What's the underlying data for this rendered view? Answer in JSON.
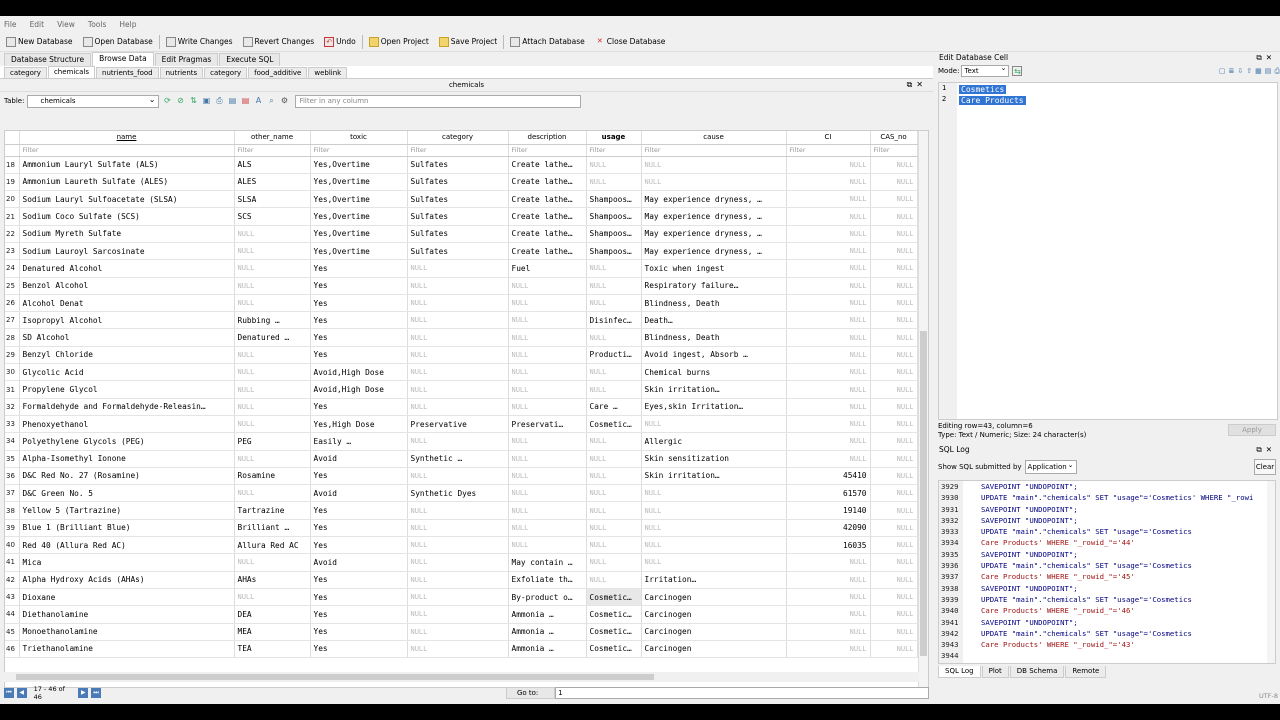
{
  "menu": [
    "File",
    "Edit",
    "View",
    "Tools",
    "Help"
  ],
  "toolbar": {
    "new_db": "New Database",
    "open_db": "Open Database",
    "write": "Write Changes",
    "revert": "Revert Changes",
    "undo": "Undo",
    "open_proj": "Open Project",
    "save_proj": "Save Project",
    "attach": "Attach Database",
    "close_db": "Close Database"
  },
  "main_tabs": [
    "Database Structure",
    "Browse Data",
    "Edit Pragmas",
    "Execute SQL"
  ],
  "sub_tabs": [
    "category",
    "chemicals",
    "nutrients_food",
    "nutrients",
    "category",
    "food_additive",
    "weblink"
  ],
  "panel_title": "chemicals",
  "table_label": "Table:",
  "table_name": "chemicals",
  "filter_any_placeholder": "Filter in any column",
  "columns": [
    "name",
    "other_name",
    "toxic",
    "category",
    "description",
    "usage",
    "cause",
    "CI",
    "CAS_no"
  ],
  "filter_placeholder": "Filter",
  "rows": [
    [
      "18",
      "Ammonium Lauryl Sulfate (ALS)",
      "ALS",
      "Yes,Overtime",
      "Sulfates",
      "Create lathe…",
      "NULL",
      "NULL",
      "NULL",
      "NULL"
    ],
    [
      "19",
      "Ammonium Laureth Sulfate (ALES)",
      "ALES",
      "Yes,Overtime",
      "Sulfates",
      "Create lathe…",
      "NULL",
      "NULL",
      "NULL",
      "NULL"
    ],
    [
      "20",
      "Sodium Lauryl Sulfoacetate (SLSA)",
      "SLSA",
      "Yes,Overtime",
      "Sulfates",
      "Create lathe…",
      "Shampoos…",
      "May experience dryness, …",
      "NULL",
      "NULL"
    ],
    [
      "21",
      "Sodium Coco Sulfate (SCS)",
      "SCS",
      "Yes,Overtime",
      "Sulfates",
      "Create lathe…",
      "Shampoos…",
      "May experience dryness, …",
      "NULL",
      "NULL"
    ],
    [
      "22",
      "Sodium Myreth Sulfate",
      "NULL",
      "Yes,Overtime",
      "Sulfates",
      "Create lathe…",
      "Shampoos…",
      "May experience dryness, …",
      "NULL",
      "NULL"
    ],
    [
      "23",
      "Sodium Lauroyl Sarcosinate",
      "NULL",
      "Yes,Overtime",
      "Sulfates",
      "Create lathe…",
      "Shampoos…",
      "May experience dryness, …",
      "NULL",
      "NULL"
    ],
    [
      "24",
      "Denatured Alcohol",
      "NULL",
      "Yes",
      "NULL",
      "Fuel",
      "NULL",
      "Toxic when ingest",
      "NULL",
      "NULL"
    ],
    [
      "25",
      "Benzol Alcohol",
      "NULL",
      "Yes",
      "NULL",
      "NULL",
      "NULL",
      "Respiratory failure…",
      "NULL",
      "NULL"
    ],
    [
      "26",
      "Alcohol Denat",
      "NULL",
      "Yes",
      "NULL",
      "NULL",
      "NULL",
      "Blindness, Death",
      "NULL",
      "NULL"
    ],
    [
      "27",
      "Isopropyl Alcohol",
      "Rubbing …",
      "Yes",
      "NULL",
      "NULL",
      "Disinfec…",
      "Death…",
      "NULL",
      "NULL"
    ],
    [
      "28",
      "SD Alcohol",
      "Denatured …",
      "Yes",
      "NULL",
      "NULL",
      "NULL",
      "Blindness, Death",
      "NULL",
      "NULL"
    ],
    [
      "29",
      "Benzyl Chloride",
      "NULL",
      "Yes",
      "NULL",
      "NULL",
      "Producti…",
      "Avoid ingest, Absorb …",
      "NULL",
      "NULL"
    ],
    [
      "30",
      "Glycolic Acid",
      "NULL",
      "Avoid,High Dose",
      "NULL",
      "NULL",
      "NULL",
      "Chemical burns",
      "NULL",
      "NULL"
    ],
    [
      "31",
      "Propylene Glycol",
      "NULL",
      "Avoid,High Dose",
      "NULL",
      "NULL",
      "NULL",
      "Skin irritation…",
      "NULL",
      "NULL"
    ],
    [
      "32",
      "Formaldehyde and Formaldehyde-Releasin…",
      "NULL",
      "Yes",
      "NULL",
      "NULL",
      "Care …",
      "Eyes,skin Irritation…",
      "NULL",
      "NULL"
    ],
    [
      "33",
      "Phenoxyethanol",
      "NULL",
      "Yes,High Dose",
      "Preservative",
      "Preservati…",
      "Cosmetic…",
      "NULL",
      "NULL",
      "NULL"
    ],
    [
      "34",
      "Polyethylene Glycols (PEG)",
      "PEG",
      "Easily …",
      "NULL",
      "NULL",
      "NULL",
      "Allergic",
      "NULL",
      "NULL"
    ],
    [
      "35",
      "Alpha-Isomethyl Ionone",
      "NULL",
      "Avoid",
      "Synthetic …",
      "NULL",
      "NULL",
      "Skin sensitization",
      "NULL",
      "NULL"
    ],
    [
      "36",
      "D&C Red No. 27 (Rosamine)",
      "Rosamine",
      "Yes",
      "NULL",
      "NULL",
      "NULL",
      "Skin irritation…",
      "45410",
      "NULL"
    ],
    [
      "37",
      "D&C Green No. 5",
      "NULL",
      "Avoid",
      "Synthetic Dyes",
      "NULL",
      "NULL",
      "NULL",
      "61570",
      "NULL"
    ],
    [
      "38",
      "Yellow 5 (Tartrazine)",
      "Tartrazine",
      "Yes",
      "NULL",
      "NULL",
      "NULL",
      "NULL",
      "19140",
      "NULL"
    ],
    [
      "39",
      "Blue 1 (Brilliant Blue)",
      "Brilliant …",
      "Yes",
      "NULL",
      "NULL",
      "NULL",
      "NULL",
      "42090",
      "NULL"
    ],
    [
      "40",
      "Red 40 (Allura Red AC)",
      "Allura Red AC",
      "Yes",
      "NULL",
      "NULL",
      "NULL",
      "NULL",
      "16035",
      "NULL"
    ],
    [
      "41",
      "Mica",
      "NULL",
      "Avoid",
      "NULL",
      "May contain …",
      "NULL",
      "NULL",
      "NULL",
      "NULL"
    ],
    [
      "42",
      "Alpha Hydroxy Acids (AHAs)",
      "AHAs",
      "Yes",
      "NULL",
      "Exfoliate th…",
      "NULL",
      "Irritation…",
      "NULL",
      "NULL"
    ],
    [
      "43",
      "Dioxane",
      "NULL",
      "Yes",
      "NULL",
      "By-product o…",
      "Cosmetic…",
      "Carcinogen",
      "NULL",
      "NULL"
    ],
    [
      "44",
      "Diethanolamine",
      "DEA",
      "Yes",
      "NULL",
      "Ammonia …",
      "Cosmetic…",
      "Carcinogen",
      "NULL",
      "NULL"
    ],
    [
      "45",
      "Monoethanolamine",
      "MEA",
      "Yes",
      "NULL",
      "Ammonia …",
      "Cosmetic…",
      "Carcinogen",
      "NULL",
      "NULL"
    ],
    [
      "46",
      "Triethanolamine",
      "TEA",
      "Yes",
      "NULL",
      "Ammonia …",
      "Cosmetic…",
      "Carcinogen",
      "NULL",
      "NULL"
    ]
  ],
  "nav": {
    "range": "17 - 46 of 46",
    "goto_label": "Go to:",
    "goto_value": "1"
  },
  "edit_cell": {
    "title": "Edit Database Cell",
    "mode_label": "Mode:",
    "mode": "Text",
    "lines": [
      "Cosmetics",
      "Care Products"
    ],
    "status1": "Editing row=43, column=6",
    "status2": "Type: Text / Numeric; Size: 24 character(s)",
    "apply": "Apply"
  },
  "sql_log": {
    "title": "SQL Log",
    "show_label": "Show SQL submitted by",
    "source": "Application",
    "clear": "Clear",
    "lines": [
      {
        "n": "3929",
        "t": "SAVEPOINT \"UNDOPOINT\";",
        "c": "blk"
      },
      {
        "n": "3930",
        "t": "UPDATE \"main\".\"chemicals\" SET \"usage\"='Cosmetics' WHERE \"_rowi",
        "c": "blk"
      },
      {
        "n": "3931",
        "t": "SAVEPOINT \"UNDOPOINT\";",
        "c": "blk"
      },
      {
        "n": "3932",
        "t": "SAVEPOINT \"UNDOPOINT\";",
        "c": "blk"
      },
      {
        "n": "3933",
        "t": "UPDATE \"main\".\"chemicals\" SET \"usage\"='Cosmetics",
        "c": "blk"
      },
      {
        "n": "3934",
        "t": "Care Products' WHERE \"_rowid_\"='44'",
        "c": "red"
      },
      {
        "n": "3935",
        "t": "SAVEPOINT \"UNDOPOINT\";",
        "c": "blk"
      },
      {
        "n": "3936",
        "t": "UPDATE \"main\".\"chemicals\" SET \"usage\"='Cosmetics",
        "c": "blk"
      },
      {
        "n": "3937",
        "t": "Care Products' WHERE \"_rowid_\"='45'",
        "c": "red"
      },
      {
        "n": "3938",
        "t": "SAVEPOINT \"UNDOPOINT\";",
        "c": "blk"
      },
      {
        "n": "3939",
        "t": "UPDATE \"main\".\"chemicals\" SET \"usage\"='Cosmetics",
        "c": "blk"
      },
      {
        "n": "3940",
        "t": "Care Products' WHERE \"_rowid_\"='46'",
        "c": "red"
      },
      {
        "n": "3941",
        "t": "SAVEPOINT \"UNDOPOINT\";",
        "c": "blk"
      },
      {
        "n": "3942",
        "t": "UPDATE \"main\".\"chemicals\" SET \"usage\"='Cosmetics",
        "c": "blk"
      },
      {
        "n": "3943",
        "t": "Care Products' WHERE \"_rowid_\"='43'",
        "c": "red"
      },
      {
        "n": "3944",
        "t": "",
        "c": "blk"
      }
    ]
  },
  "bottom_tabs": [
    "SQL Log",
    "Plot",
    "DB Schema",
    "Remote"
  ],
  "encoding": "UTF-8"
}
